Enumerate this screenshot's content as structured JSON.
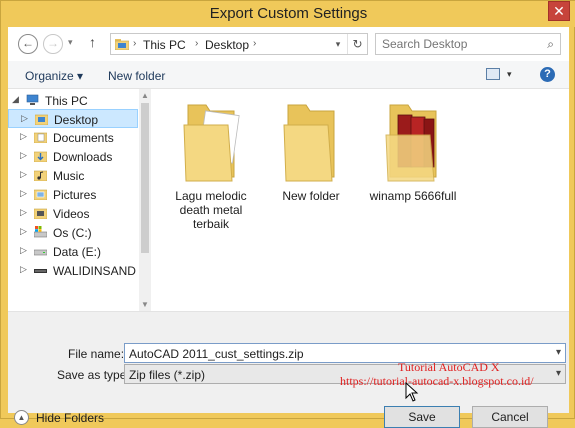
{
  "window": {
    "title": "Export Custom Settings",
    "close_glyph": "✕"
  },
  "nav": {
    "back_glyph": "←",
    "forward_glyph": "→",
    "recent_glyph": "▾",
    "up_glyph": "↑",
    "address": {
      "segments": [
        "This PC",
        "Desktop"
      ],
      "separator": "›",
      "dropdown_glyph": "▾",
      "refresh_glyph": "↻"
    },
    "search": {
      "placeholder": "Search Desktop",
      "icon": "search-icon",
      "glyph": "⌕"
    }
  },
  "toolbar": {
    "organize_label": "Organize ▾",
    "new_folder_label": "New folder",
    "view_chev": "▾",
    "help_glyph": "?"
  },
  "tree": [
    {
      "label": "This PC",
      "icon": "computer-icon",
      "arrow": "◢",
      "selected": false
    },
    {
      "label": "Desktop",
      "icon": "desktop-folder-icon",
      "arrow": "▷",
      "selected": true
    },
    {
      "label": "Documents",
      "icon": "documents-folder-icon",
      "arrow": "▷",
      "selected": false
    },
    {
      "label": "Downloads",
      "icon": "downloads-folder-icon",
      "arrow": "▷",
      "selected": false
    },
    {
      "label": "Music",
      "icon": "music-folder-icon",
      "arrow": "▷",
      "selected": false
    },
    {
      "label": "Pictures",
      "icon": "pictures-folder-icon",
      "arrow": "▷",
      "selected": false
    },
    {
      "label": "Videos",
      "icon": "videos-folder-icon",
      "arrow": "▷",
      "selected": false
    },
    {
      "label": "Os (C:)",
      "icon": "drive-c-icon",
      "arrow": "▷",
      "selected": false
    },
    {
      "label": "Data (E:)",
      "icon": "drive-e-icon",
      "arrow": "▷",
      "selected": false
    },
    {
      "label": "WALIDINSAND (F",
      "icon": "usb-drive-icon",
      "arrow": "▷",
      "selected": false
    }
  ],
  "scroll": {
    "up": "▲",
    "down": "▼",
    "left": "◀",
    "right": "▶"
  },
  "files": [
    {
      "label": "Lagu melodic death metal terbaik",
      "icon": "folder-with-docs-icon"
    },
    {
      "label": "New folder",
      "icon": "folder-icon"
    },
    {
      "label": "winamp 5666full",
      "icon": "folder-with-books-icon"
    }
  ],
  "form": {
    "file_name_label": "File name:",
    "file_name_value": "AutoCAD 2011_cust_settings.zip",
    "save_type_label": "Save as type:",
    "save_type_value": "Zip files (*.zip)",
    "chev": "▾"
  },
  "footer": {
    "hide_folders_label": "Hide Folders",
    "hide_glyph": "▲",
    "save_label": "Save",
    "cancel_label": "Cancel"
  },
  "watermark": {
    "line1": "Tutorial AutoCAD X",
    "line2": "https://tutorial-autocad-x.blogspot.co.id/"
  },
  "colors": {
    "title_bar": "#f0c95a",
    "close": "#c7443b",
    "selection": "#cce8ff",
    "watermark": "#e02020",
    "folder": "#f2d27a"
  }
}
